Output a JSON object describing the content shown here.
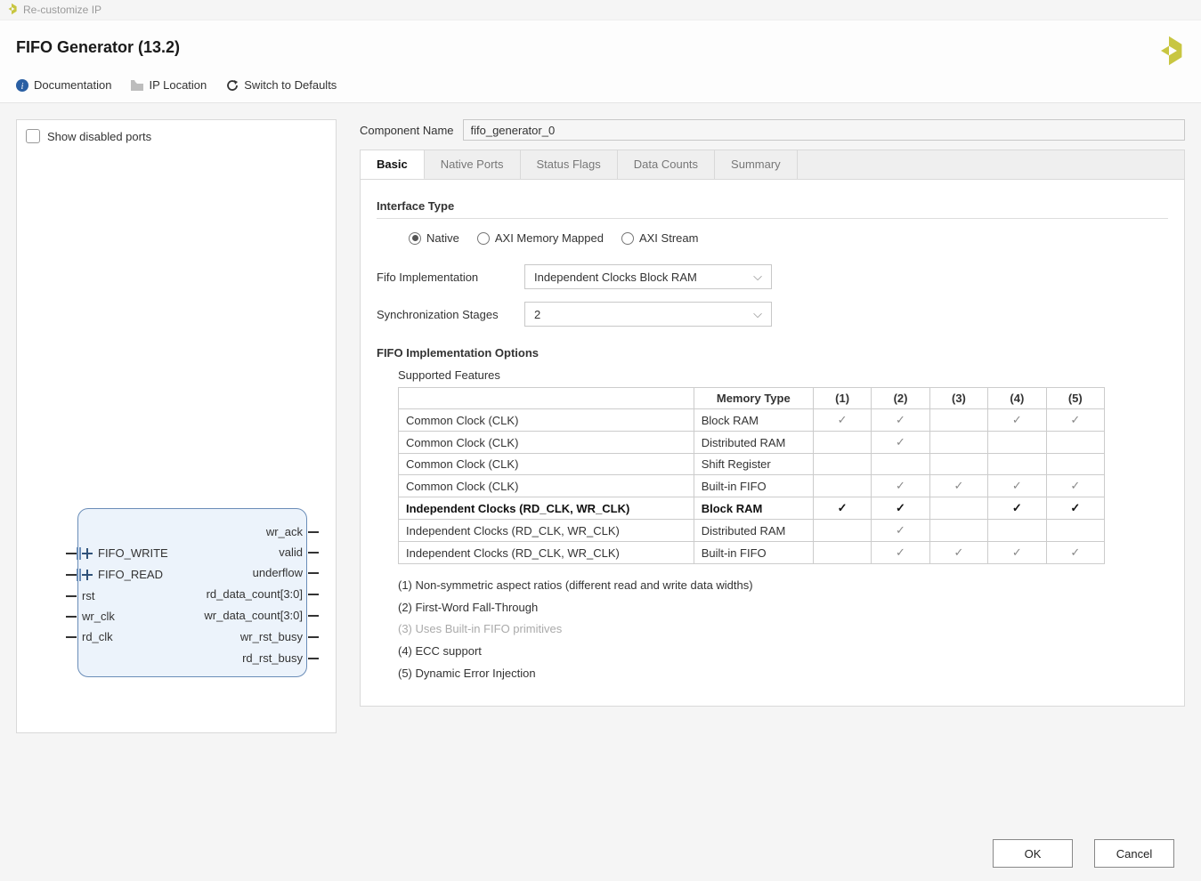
{
  "window_title": "Re-customize IP",
  "header_title": "FIFO Generator (13.2)",
  "links": {
    "doc": "Documentation",
    "iploc": "IP Location",
    "defaults": "Switch to Defaults"
  },
  "preview": {
    "show_disabled": "Show disabled ports",
    "left_ports": [
      "FIFO_WRITE",
      "FIFO_READ",
      "rst",
      "wr_clk",
      "rd_clk"
    ],
    "right_ports": [
      "wr_ack",
      "valid",
      "underflow",
      "rd_data_count[3:0]",
      "wr_data_count[3:0]",
      "wr_rst_busy",
      "rd_rst_busy"
    ]
  },
  "component": {
    "label": "Component Name",
    "value": "fifo_generator_0"
  },
  "tabs": [
    "Basic",
    "Native Ports",
    "Status Flags",
    "Data Counts",
    "Summary"
  ],
  "basic": {
    "iface_title": "Interface Type",
    "iface_opts": [
      "Native",
      "AXI Memory Mapped",
      "AXI Stream"
    ],
    "impl_label": "Fifo Implementation",
    "impl_value": "Independent Clocks Block RAM",
    "sync_label": "Synchronization Stages",
    "sync_value": "2",
    "opts_title": "FIFO Implementation Options",
    "feat_title": "Supported Features",
    "cols": [
      "",
      "Memory Type",
      "(1)",
      "(2)",
      "(3)",
      "(4)",
      "(5)"
    ],
    "rows": [
      {
        "c": "Common Clock (CLK)",
        "m": "Block RAM",
        "k": [
          "✓",
          "✓",
          "",
          "✓",
          "✓"
        ],
        "b": 0
      },
      {
        "c": "Common Clock (CLK)",
        "m": "Distributed RAM",
        "k": [
          "",
          "✓",
          "",
          "",
          ""
        ],
        "b": 0
      },
      {
        "c": "Common Clock (CLK)",
        "m": "Shift Register",
        "k": [
          "",
          "",
          "",
          "",
          ""
        ],
        "b": 0
      },
      {
        "c": "Common Clock (CLK)",
        "m": "Built-in FIFO",
        "k": [
          "",
          "✓",
          "✓",
          "✓",
          "✓"
        ],
        "b": 0
      },
      {
        "c": "Independent Clocks (RD_CLK, WR_CLK)",
        "m": "Block RAM",
        "k": [
          "✓",
          "✓",
          "",
          "✓",
          "✓"
        ],
        "b": 1
      },
      {
        "c": "Independent Clocks (RD_CLK, WR_CLK)",
        "m": "Distributed RAM",
        "k": [
          "",
          "✓",
          "",
          "",
          ""
        ],
        "b": 0
      },
      {
        "c": "Independent Clocks (RD_CLK, WR_CLK)",
        "m": "Built-in FIFO",
        "k": [
          "",
          "✓",
          "✓",
          "✓",
          "✓"
        ],
        "b": 0
      }
    ],
    "legend": [
      "(1) Non-symmetric aspect ratios (different read and write data widths)",
      "(2) First-Word Fall-Through",
      "(3) Uses Built-in FIFO primitives",
      "(4) ECC support",
      "(5) Dynamic Error Injection"
    ]
  },
  "buttons": {
    "ok": "OK",
    "cancel": "Cancel"
  }
}
